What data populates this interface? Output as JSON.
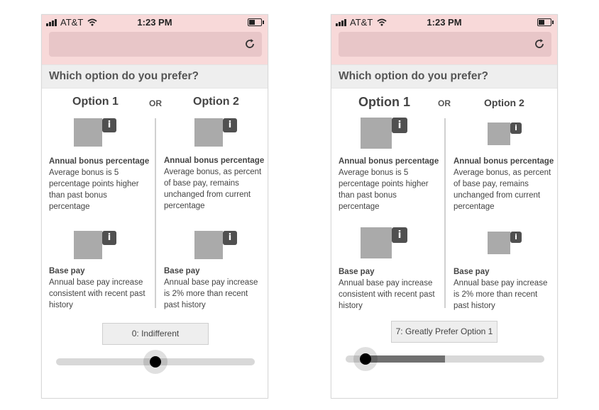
{
  "colors": {
    "chrome_bg": "#f8d9d9",
    "urlbar_bg": "#e8c6c8",
    "image_placeholder": "#aaaaaa",
    "info_button": "#505050",
    "slider_track": "#d8d8d8",
    "slider_fill": "#707070"
  },
  "screens": [
    {
      "status": {
        "carrier": "AT&T",
        "time": "1:23 PM"
      },
      "question": "Which option do you prefer?",
      "option1": "Option 1",
      "or": "OR",
      "option2": "Option 2",
      "attributes": [
        {
          "name": "Annual bonus percentage",
          "option1": "Average bonus is 5 percentage points higher than past bonus percentage",
          "option2": "Average bonus, as percent of base pay, remains unchanged from current percentage"
        },
        {
          "name": "Base pay",
          "option1": "Annual base pay increase consistent with recent past history",
          "option2": "Annual base pay increase is 2% more than recent past history"
        }
      ],
      "info_label": "i",
      "slider": {
        "label": "0: Indifferent",
        "value": 0,
        "position": 0.5
      }
    },
    {
      "status": {
        "carrier": "AT&T",
        "time": "1:23 PM"
      },
      "question": "Which option do you prefer?",
      "option1": "Option 1",
      "or": "OR",
      "option2": "Option 2",
      "attributes": [
        {
          "name": "Annual bonus percentage",
          "option1": "Average bonus is 5 percentage points higher than past bonus percentage",
          "option2": "Average bonus, as percent of base pay, remains unchanged from current percentage"
        },
        {
          "name": "Base pay",
          "option1": "Annual base pay increase consistent with recent past history",
          "option2": "Annual base pay increase is 2% more than recent past history"
        }
      ],
      "info_label": "i",
      "slider": {
        "label": "7: Greatly Prefer Option 1",
        "value": 7,
        "position": 0.1
      }
    }
  ]
}
